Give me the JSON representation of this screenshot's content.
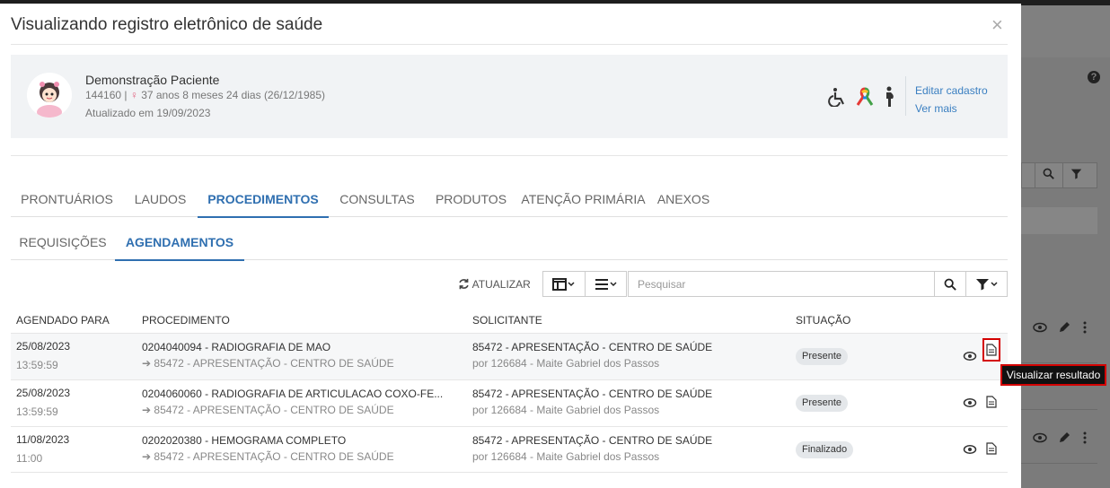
{
  "modal": {
    "title": "Visualizando registro eletrônico de saúde",
    "close": "×"
  },
  "patient": {
    "name": "Demonstração Paciente",
    "id": "144160",
    "age": "37 anos 8 meses 24 dias (26/12/1985)",
    "updated": "Atualizado em 19/09/2023",
    "edit_label": "Editar cadastro",
    "more_label": "Ver mais",
    "icons": [
      "wheelchair-icon",
      "awareness-ribbon-icon",
      "pregnant-person-icon"
    ]
  },
  "main_tabs": [
    "PRONTUÁRIOS",
    "LAUDOS",
    "PROCEDIMENTOS",
    "CONSULTAS",
    "PRODUTOS",
    "ATENÇÃO PRIMÁRIA",
    "ANEXOS"
  ],
  "main_tab_active": "PROCEDIMENTOS",
  "sub_tabs": [
    "REQUISIÇÕES",
    "AGENDAMENTOS"
  ],
  "sub_tab_active": "AGENDAMENTOS",
  "toolbar": {
    "refresh_label": "ATUALIZAR",
    "search_placeholder": "Pesquisar"
  },
  "table": {
    "headers": [
      "AGENDADO PARA",
      "PROCEDIMENTO",
      "SOLICITANTE",
      "SITUAÇÃO"
    ],
    "rows": [
      {
        "date": "25/08/2023",
        "time": "13:59:59",
        "procedure": "0204040094 - RADIOGRAFIA DE MAO",
        "procedure_sub": "85472 - APRESENTAÇÃO - CENTRO DE SAÚDE",
        "requester": "85472 - APRESENTAÇÃO - CENTRO DE SAÚDE",
        "requester_sub": "por 126684 - Maite Gabriel dos Passos",
        "status": "Presente"
      },
      {
        "date": "25/08/2023",
        "time": "13:59:59",
        "procedure": "0204060060 - RADIOGRAFIA DE ARTICULACAO COXO-FE...",
        "procedure_sub": "85472 - APRESENTAÇÃO - CENTRO DE SAÚDE",
        "requester": "85472 - APRESENTAÇÃO - CENTRO DE SAÚDE",
        "requester_sub": "por 126684 - Maite Gabriel dos Passos",
        "status": "Presente"
      },
      {
        "date": "11/08/2023",
        "time": "11:00",
        "procedure": "0202020380 - HEMOGRAMA COMPLETO",
        "procedure_sub": "85472 - APRESENTAÇÃO - CENTRO DE SAÚDE",
        "requester": "85472 - APRESENTAÇÃO - CENTRO DE SAÚDE",
        "requester_sub": "por 126684 - Maite Gabriel dos Passos",
        "status": "Finalizado"
      }
    ]
  },
  "tooltip": "Visualizar resultado",
  "background": {
    "help": "?"
  },
  "colors": {
    "accent": "#2f6fb0",
    "link": "#3a7fc1",
    "highlight": "#d40000",
    "female": "#e0607e"
  }
}
